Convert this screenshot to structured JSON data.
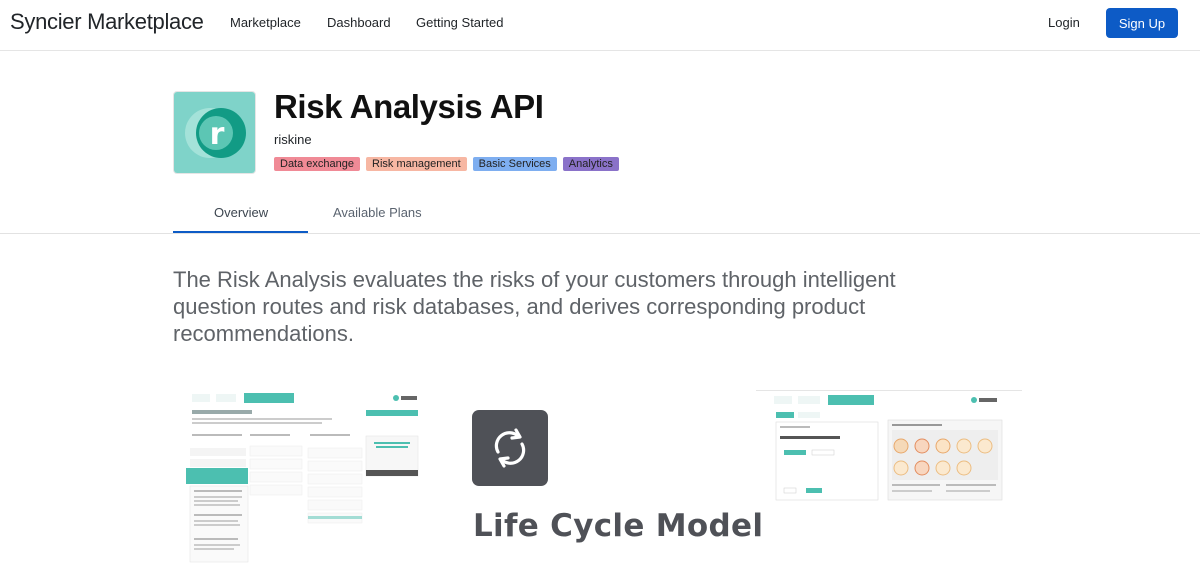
{
  "navbar": {
    "brand": "Syncier Marketplace",
    "links": [
      "Marketplace",
      "Dashboard",
      "Getting Started"
    ],
    "login": "Login",
    "signup": "Sign Up"
  },
  "app": {
    "title": "Risk Analysis API",
    "vendor": "riskine",
    "logo_letter": "r",
    "tags": [
      {
        "label": "Data exchange",
        "color": "#f08a96"
      },
      {
        "label": "Risk management",
        "color": "#f7b7a3"
      },
      {
        "label": "Basic Services",
        "color": "#7eaef0"
      },
      {
        "label": "Analytics",
        "color": "#8a72c9"
      }
    ]
  },
  "tabs": [
    {
      "label": "Overview",
      "active": true
    },
    {
      "label": "Available Plans",
      "active": false
    }
  ],
  "description": "The Risk Analysis evaluates the risks of your customers through intelligent question routes and risk databases, and derives corresponding product recommendations.",
  "screenshots": {
    "left": {
      "heading": "UNSERE EMPFEHLUNG FÜR SIE!",
      "brand": "riskine"
    },
    "middle": {
      "caption": "Life Cycle Model"
    },
    "right": {
      "question": "Sind Sie männlich oder weiblich?",
      "brand": "riskine"
    }
  },
  "colors": {
    "accent": "#0d5bc6",
    "teal": "#3fb9a9",
    "logo_bg": "#7fd3c9",
    "dark_icon": "#4f5157"
  }
}
